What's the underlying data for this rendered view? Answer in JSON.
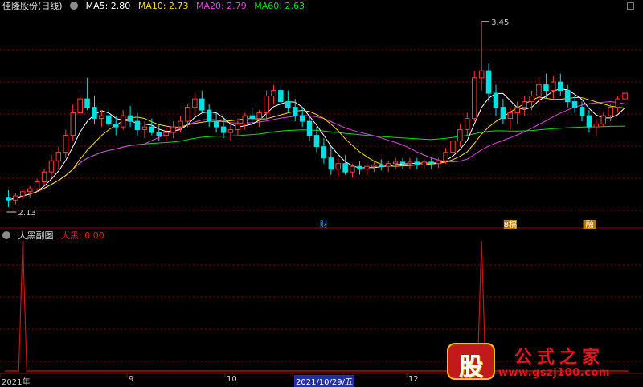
{
  "header": {
    "stock_title": "佳隆股份(日线)",
    "ma_readouts": [
      {
        "text": "MA5: 2.80",
        "color": "#ffffff"
      },
      {
        "text": "MA10: 2.73",
        "color": "#ffd700"
      },
      {
        "text": "MA20: 2.79",
        "color": "#e040e0"
      },
      {
        "text": "MA60: 2.63",
        "color": "#00e000"
      }
    ]
  },
  "sub_header": {
    "indicator_name": "大黑副图",
    "indicator_value": "大黑: 0.00"
  },
  "x_axis": {
    "labels": [
      {
        "text": "2021年",
        "highlight": false
      },
      {
        "text": "9",
        "highlight": false
      },
      {
        "text": "10",
        "highlight": false
      },
      {
        "text": "2021/10/29/五",
        "highlight": true
      },
      {
        "text": "12",
        "highlight": false
      }
    ]
  },
  "event_markers": [
    "财",
    "8稿",
    "融"
  ],
  "watermark": {
    "logo_char": "股",
    "title": "公式之家",
    "url": "www.gszj100.com"
  },
  "colors": {
    "up": "#ff3c3c",
    "down": "#00e0e0",
    "ma5": "#ffffff",
    "ma10": "#ffd700",
    "ma20": "#e040e0",
    "ma60": "#00e000",
    "indicator": "#d01010",
    "grid": "#7a0000"
  },
  "chart_data": [
    {
      "type": "candlestick",
      "title": "佳隆股份(日线)",
      "price_annotations": {
        "high": 3.45,
        "low": 2.13
      },
      "ylim": [
        2.05,
        3.5
      ],
      "grid": true,
      "series_summary": [
        "MA5",
        "MA10",
        "MA20",
        "MA60"
      ],
      "candles": [
        [
          2.2,
          2.25,
          2.13,
          2.18
        ],
        [
          2.18,
          2.23,
          2.15,
          2.21
        ],
        [
          2.21,
          2.26,
          2.18,
          2.24
        ],
        [
          2.24,
          2.28,
          2.2,
          2.26
        ],
        [
          2.26,
          2.33,
          2.24,
          2.31
        ],
        [
          2.31,
          2.4,
          2.28,
          2.38
        ],
        [
          2.38,
          2.5,
          2.34,
          2.46
        ],
        [
          2.46,
          2.56,
          2.4,
          2.52
        ],
        [
          2.52,
          2.68,
          2.48,
          2.64
        ],
        [
          2.64,
          2.86,
          2.6,
          2.8
        ],
        [
          2.8,
          2.95,
          2.75,
          2.9
        ],
        [
          2.9,
          3.05,
          2.82,
          2.84
        ],
        [
          2.84,
          2.92,
          2.72,
          2.76
        ],
        [
          2.76,
          2.82,
          2.7,
          2.78
        ],
        [
          2.78,
          2.84,
          2.7,
          2.72
        ],
        [
          2.72,
          2.78,
          2.64,
          2.7
        ],
        [
          2.7,
          2.82,
          2.68,
          2.78
        ],
        [
          2.78,
          2.85,
          2.7,
          2.74
        ],
        [
          2.74,
          2.8,
          2.64,
          2.68
        ],
        [
          2.68,
          2.74,
          2.62,
          2.7
        ],
        [
          2.7,
          2.76,
          2.64,
          2.66
        ],
        [
          2.66,
          2.72,
          2.6,
          2.64
        ],
        [
          2.64,
          2.7,
          2.6,
          2.66
        ],
        [
          2.66,
          2.74,
          2.62,
          2.7
        ],
        [
          2.7,
          2.78,
          2.66,
          2.74
        ],
        [
          2.74,
          2.86,
          2.7,
          2.84
        ],
        [
          2.84,
          2.94,
          2.78,
          2.9
        ],
        [
          2.9,
          2.96,
          2.8,
          2.82
        ],
        [
          2.82,
          2.86,
          2.7,
          2.74
        ],
        [
          2.74,
          2.8,
          2.66,
          2.7
        ],
        [
          2.7,
          2.76,
          2.62,
          2.66
        ],
        [
          2.66,
          2.72,
          2.6,
          2.68
        ],
        [
          2.68,
          2.76,
          2.64,
          2.72
        ],
        [
          2.72,
          2.8,
          2.68,
          2.78
        ],
        [
          2.78,
          2.84,
          2.72,
          2.76
        ],
        [
          2.76,
          2.82,
          2.7,
          2.8
        ],
        [
          2.8,
          2.96,
          2.76,
          2.92
        ],
        [
          2.92,
          3.0,
          2.86,
          2.96
        ],
        [
          2.96,
          2.99,
          2.86,
          2.88
        ],
        [
          2.88,
          2.96,
          2.8,
          2.84
        ],
        [
          2.84,
          2.9,
          2.74,
          2.78
        ],
        [
          2.78,
          2.84,
          2.7,
          2.74
        ],
        [
          2.74,
          2.78,
          2.6,
          2.64
        ],
        [
          2.64,
          2.7,
          2.52,
          2.56
        ],
        [
          2.56,
          2.62,
          2.44,
          2.48
        ],
        [
          2.48,
          2.56,
          2.36,
          2.4
        ],
        [
          2.4,
          2.48,
          2.34,
          2.44
        ],
        [
          2.44,
          2.5,
          2.36,
          2.38
        ],
        [
          2.38,
          2.44,
          2.34,
          2.42
        ],
        [
          2.42,
          2.46,
          2.36,
          2.4
        ],
        [
          2.4,
          2.44,
          2.36,
          2.42
        ],
        [
          2.42,
          2.46,
          2.38,
          2.43
        ],
        [
          2.43,
          2.47,
          2.39,
          2.42
        ],
        [
          2.42,
          2.46,
          2.38,
          2.44
        ],
        [
          2.44,
          2.48,
          2.4,
          2.45
        ],
        [
          2.45,
          2.48,
          2.4,
          2.44
        ],
        [
          2.44,
          2.48,
          2.4,
          2.45
        ],
        [
          2.45,
          2.48,
          2.4,
          2.43
        ],
        [
          2.43,
          2.47,
          2.4,
          2.45
        ],
        [
          2.45,
          2.48,
          2.4,
          2.44
        ],
        [
          2.44,
          2.48,
          2.41,
          2.46
        ],
        [
          2.46,
          2.55,
          2.44,
          2.52
        ],
        [
          2.52,
          2.64,
          2.5,
          2.6
        ],
        [
          2.6,
          2.72,
          2.56,
          2.68
        ],
        [
          2.68,
          2.8,
          2.64,
          2.76
        ],
        [
          2.76,
          3.1,
          2.74,
          3.05
        ],
        [
          3.05,
          3.45,
          2.96,
          3.1
        ],
        [
          3.1,
          3.15,
          2.88,
          2.94
        ],
        [
          2.94,
          3.0,
          2.78,
          2.84
        ],
        [
          2.84,
          2.9,
          2.72,
          2.76
        ],
        [
          2.76,
          2.84,
          2.68,
          2.8
        ],
        [
          2.8,
          2.88,
          2.72,
          2.84
        ],
        [
          2.84,
          2.92,
          2.78,
          2.88
        ],
        [
          2.88,
          2.96,
          2.82,
          2.92
        ],
        [
          2.92,
          3.05,
          2.86,
          3.0
        ],
        [
          3.0,
          3.08,
          2.9,
          2.96
        ],
        [
          2.96,
          3.06,
          2.9,
          3.02
        ],
        [
          3.02,
          3.08,
          2.92,
          2.96
        ],
        [
          2.96,
          3.0,
          2.84,
          2.88
        ],
        [
          2.88,
          2.92,
          2.8,
          2.84
        ],
        [
          2.84,
          2.88,
          2.74,
          2.78
        ],
        [
          2.78,
          2.82,
          2.66,
          2.7
        ],
        [
          2.7,
          2.76,
          2.64,
          2.72
        ],
        [
          2.72,
          2.8,
          2.7,
          2.78
        ],
        [
          2.78,
          2.86,
          2.74,
          2.84
        ],
        [
          2.84,
          2.92,
          2.8,
          2.9
        ],
        [
          2.9,
          2.96,
          2.86,
          2.94
        ]
      ]
    },
    {
      "type": "line",
      "title": "大黑副图",
      "series": [
        {
          "name": "大黑",
          "spikes_at_candle_index": [
            2,
            66
          ]
        }
      ],
      "ylim": [
        0,
        1
      ]
    }
  ]
}
